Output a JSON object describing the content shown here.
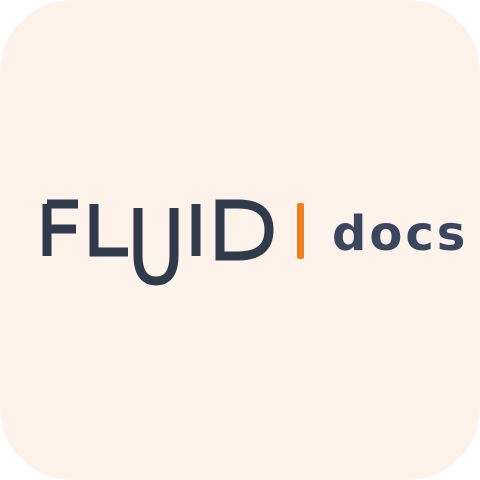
{
  "logo": {
    "wordmark": "FLUID",
    "suffix": "docs"
  },
  "colors": {
    "background": "#fdf3ea",
    "wordmark": "#2f3a4b",
    "divider": "#f07f1f",
    "suffix": "#3b4660"
  }
}
